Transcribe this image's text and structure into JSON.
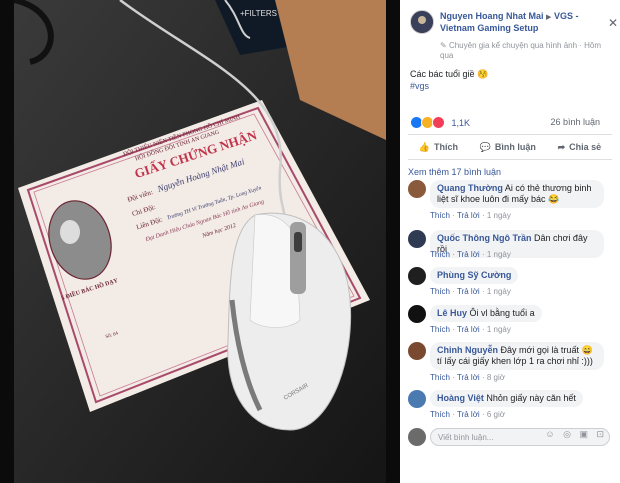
{
  "photo": {
    "label": "GIẤY CHỨNG NHẬN",
    "cert_lines": [
      "ĐỘI THIẾU NIÊN TIỀN PHONG HỒ CHÍ MINH",
      "HỘI ĐỒNG ĐỘI TỈNH AN GIANG"
    ],
    "name_field": "Đội viên:",
    "name_value": "Nguyễn Hoàng Nhật Mai",
    "chi_doi": "Chi Đội:",
    "lien_doi": "Liên Đội:",
    "lien_doi_value": "Trường TH Vĩ Trường Tuấn, Tp. Long Xuyên",
    "achievement": "Đạt Danh Hiệu Cháu Ngoan Bác Hồ tỉnh An Giang",
    "year": "Năm học 2012",
    "rules_title": "5 ĐIỀU BÁC HỒ DẠY",
    "serial": "Số: 04",
    "filters_badge": "+FILTERS",
    "mouse_brand": "CORSAIR"
  },
  "post": {
    "author": "Nguyen Hoang Nhat Mai",
    "arrow": "▶",
    "group": "VGS - Vietnam Gaming Setup",
    "badge": "Chuyên gia kể chuyện qua hình ảnh",
    "time": "Hôm qua",
    "text": "Các bác tuổi giề 😚",
    "hashtag": "#vgs",
    "reaction_count": "1,1K",
    "comment_count": "26 bình luận",
    "actions": [
      "Thích",
      "Bình luận",
      "Chia sẻ"
    ],
    "view_more": "Xem thêm 17 bình luận",
    "close": "✕"
  },
  "comments": [
    {
      "name": "Quang Thường",
      "text": "Ai có thẻ thương binh liệt sĩ khoe luôn đi mấy bác 😂",
      "like": "Thích",
      "reply": "Trả lời",
      "time": "1 ngày",
      "avatar_color": "#8a5a3c"
    },
    {
      "name": "Quốc Thông Ngô Trần",
      "text": "Dân chơi đây rồi",
      "like": "Thích",
      "reply": "Trả lời",
      "time": "1 ngày",
      "avatar_color": "#2f3b52"
    },
    {
      "name": "Phùng Sỹ Cường",
      "text": "",
      "like": "Thích",
      "reply": "Trả lời",
      "time": "1 ngày",
      "avatar_color": "#1f1f1f"
    },
    {
      "name": "Lê Huy",
      "text": "Ôi vl bằng tuổi a",
      "like": "Thích",
      "reply": "Trả lời",
      "time": "1 ngày",
      "avatar_color": "#111111"
    },
    {
      "name": "Chinh Nguyễn",
      "text": "Đây mới gọi là truất 😄 tí lấy cái giấy khen lớp 1 ra chơi nhỉ :)))",
      "like": "Thích",
      "reply": "Trả lời",
      "time": "8 giờ",
      "avatar_color": "#7a4a30"
    },
    {
      "name": "Hoàng Việt",
      "text": "Nhỏn giấy này căn hết",
      "like": "Thích",
      "reply": "Trả lời",
      "time": "6 giờ",
      "avatar_color": "#4a7ab0"
    }
  ],
  "input": {
    "placeholder": "Viết bình luận...",
    "icons": "☺ ◎ ▣ ⊡"
  }
}
